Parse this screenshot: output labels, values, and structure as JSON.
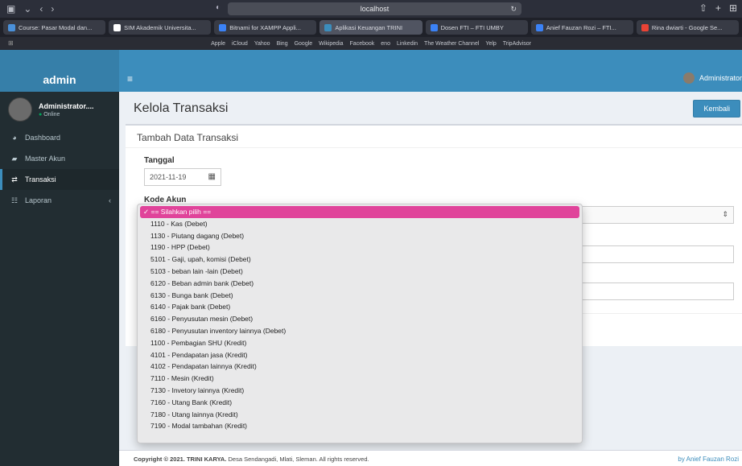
{
  "browser": {
    "url": "localhost",
    "tabs": [
      {
        "label": "Course: Pasar Modal dan...",
        "color": "#4a90d9"
      },
      {
        "label": "SIM Akademik Universita...",
        "color": "#ffffff"
      },
      {
        "label": "Bitnami for XAMPP Appli...",
        "color": "#3b82f6"
      },
      {
        "label": "Aplikasi Keuangan TRINI",
        "color": "#3c8dbc"
      },
      {
        "label": "Dosen FTI – FTI UMBY",
        "color": "#3b82f6"
      },
      {
        "label": "Anief Fauzan Rozi – FTI...",
        "color": "#3b82f6"
      },
      {
        "label": "Rina dwiarti - Google Se...",
        "color": "#ea4335"
      }
    ],
    "bookmarks": [
      "Apple",
      "iCloud",
      "Yahoo",
      "Bing",
      "Google",
      "Wikipedia",
      "Facebook",
      "eno",
      "Linkedin",
      "The Weather Channel",
      "Yelp",
      "TripAdvisor"
    ]
  },
  "app": {
    "brand": "admin",
    "top_user": "Administrator",
    "sidebar": {
      "user_name": "Administrator....",
      "status": "Online",
      "items": [
        {
          "label": "Dashboard",
          "icon": "dashboard-icon"
        },
        {
          "label": "Master Akun",
          "icon": "book-icon"
        },
        {
          "label": "Transaksi",
          "icon": "exchange-icon"
        },
        {
          "label": "Laporan",
          "icon": "report-icon"
        }
      ]
    }
  },
  "page": {
    "title": "Kelola Transaksi",
    "back_button": "Kembali",
    "box_title": "Tambah Data Transaksi",
    "date_label": "Tanggal",
    "date_value": "2021-11-19",
    "account_label": "Kode Akun"
  },
  "dropdown": {
    "options": [
      "✓ == Silahkan pilih ==",
      "1110 - Kas (Debet)",
      "1130 - Piutang dagang (Debet)",
      "1190 - HPP (Debet)",
      "5101 - Gaji, upah, komisi (Debet)",
      "5103 - beban lain -lain (Debet)",
      "6120 - Beban admin bank (Debet)",
      "6130 - Bunga bank (Debet)",
      "6140 - Pajak bank (Debet)",
      "6160 - Penyusutan mesin (Debet)",
      "6180 - Penyusutan inventory lainnya (Debet)",
      "1100 - Pembagian SHU (Kredit)",
      "4101 - Pendapatan jasa (Kredit)",
      "4102 - Pendapatan lainnya (Kredit)",
      "7110 - Mesin (Kredit)",
      "7130 - Invetory lainnya (Kredit)",
      "7160 - Utang Bank (Kredit)",
      "7180 - Utang lainnya (Kredit)",
      "7190 - Modal tambahan (Kredit)"
    ]
  },
  "footer": {
    "copyright_prefix": "Copyright © 2021.",
    "company": "TRINI KARYA.",
    "address": "Desa Sendangadi, Mlati, Sleman. All rights reserved.",
    "credit": "by Anief Fauzan Rozi"
  }
}
